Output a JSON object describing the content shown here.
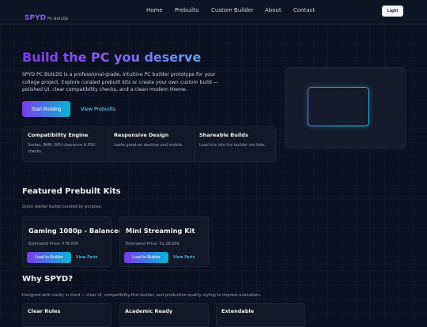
{
  "brand": {
    "name": "SPYD",
    "tagline": "PC BUILDS"
  },
  "nav": {
    "items": [
      "Home",
      "Prebuilts",
      "Custom Builder",
      "About",
      "Contact"
    ],
    "theme_toggle": "Light"
  },
  "hero": {
    "title": "Build the PC you deserve",
    "description": "SPYD PC BUILDS is a professional-grade, intuitive PC builder prototype for your college project. Explore curated prebuilt kits or create your own custom build — polished UI, clear compatibility checks, and a clean modern theme.",
    "primary_button": "Start Building",
    "secondary_button": "View Prebuilts"
  },
  "features": [
    {
      "title": "Compatibility Engine",
      "text": "Socket, RAM, GPU clearance & PSU checks."
    },
    {
      "title": "Responsive Design",
      "text": "Looks great on desktop and mobile."
    },
    {
      "title": "Shareable Builds",
      "text": "Load kits into the builder via links."
    }
  ],
  "featured": {
    "title": "Featured Prebuilt Kits",
    "subtitle": "Quick starter builds curated by purpose.",
    "kits": [
      {
        "name": "Gaming 1080p - Balanced",
        "price": "Estimated Price: ₹78,000",
        "load_label": "Load to Builder",
        "view_label": "View Parts"
      },
      {
        "name": "Mini Streaming Kit",
        "price": "Estimated Price: ₹1,28,000",
        "load_label": "Load to Builder",
        "view_label": "View Parts"
      }
    ]
  },
  "why": {
    "title": "Why SPYD?",
    "subtitle": "Designed with clarity in mind — clear UI, compatibility-first builder, and production-quality styling to impress evaluators.",
    "cards": [
      "Clear Rules",
      "Academic Ready",
      "Extendable"
    ]
  },
  "colors": {
    "background": "#0b1120",
    "accent_purple": "#7c3aed",
    "accent_cyan": "#06b6d4",
    "card": "#111827"
  }
}
